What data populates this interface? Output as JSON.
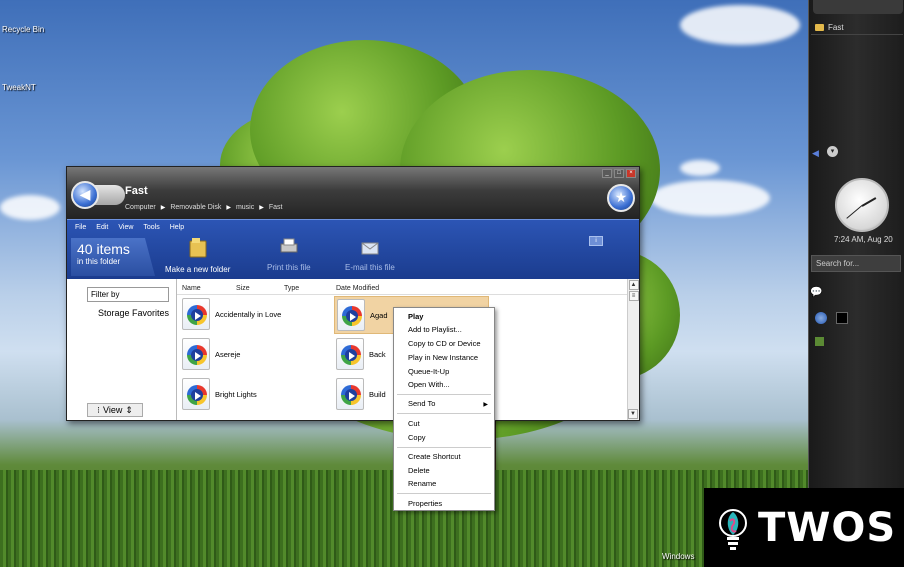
{
  "desktop": {
    "recycle_bin": "Recycle Bin",
    "tweak": "TweakNT",
    "windows_mark": "Windows"
  },
  "sidebar": {
    "folder_label": "Fast",
    "clock_time": "7:24 AM, Aug 20",
    "search_placeholder": "Search for..."
  },
  "window": {
    "title": "Fast",
    "breadcrumb": [
      "Computer",
      "Removable Disk",
      "music",
      "Fast"
    ],
    "menu": [
      "File",
      "Edit",
      "View",
      "Tools",
      "Help"
    ],
    "items_count": "40 items",
    "items_sub": "in this folder",
    "tasks": {
      "new_folder": "Make a new folder",
      "print": "Print this file",
      "email": "E-mail this file"
    },
    "filter_placeholder": "Filter by",
    "storage_favorites": "Storage Favorites",
    "view_label": "View",
    "columns": {
      "name": "Name",
      "size": "Size",
      "type": "Type",
      "date": "Date Modified"
    },
    "files": {
      "f1": "Accidentally in Love",
      "f2": "Asereje",
      "f3": "Bright Lights",
      "f4": "Agad",
      "f5": "Back",
      "f6": "Build"
    }
  },
  "context_menu": {
    "play": "Play",
    "add_playlist": "Add to Playlist...",
    "copy_cd": "Copy to CD or Device",
    "play_new": "Play in New Instance",
    "queue": "Queue-It-Up",
    "open_with": "Open With...",
    "send_to": "Send To",
    "cut": "Cut",
    "copy": "Copy",
    "create_shortcut": "Create Shortcut",
    "delete": "Delete",
    "rename": "Rename",
    "properties": "Properties"
  },
  "watermark": {
    "brand": "TWOS"
  }
}
